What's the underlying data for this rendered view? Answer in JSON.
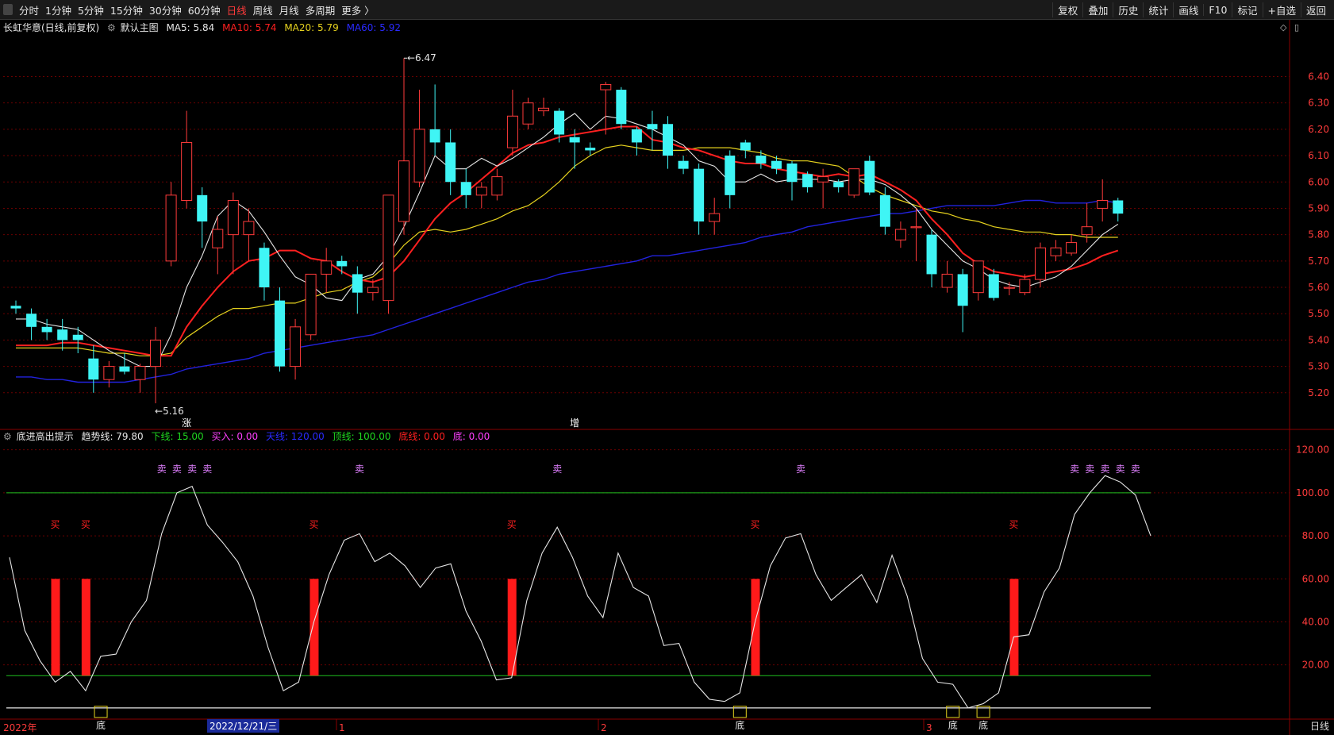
{
  "toolbar": {
    "periods": [
      "分时",
      "1分钟",
      "5分钟",
      "15分钟",
      "30分钟",
      "60分钟",
      "日线",
      "周线",
      "月线",
      "多周期",
      "更多 〉"
    ],
    "active_period": "日线",
    "tools": [
      "复权",
      "叠加",
      "历史",
      "统计",
      "画线",
      "F10",
      "标记",
      "+自选",
      "返回"
    ]
  },
  "main_legend": {
    "stock": "长虹华意(日线,前复权)",
    "view": "默认主图",
    "ma5": "MA5: 5.84",
    "ma10": "MA10: 5.74",
    "ma20": "MA20: 5.79",
    "ma60": "MA60: 5.92"
  },
  "indicator_legend": {
    "name": "底进高出提示",
    "trend": "趋势线: 79.80",
    "lower": "下线: 15.00",
    "buy": "买入: 0.00",
    "sky": "天线: 120.00",
    "top": "顶线: 100.00",
    "bottom": "底线: 0.00",
    "di": "底: 0.00"
  },
  "colors": {
    "up": "#ff3b3b",
    "down": "#3ff5f5",
    "ma5": "#e6e6e6",
    "ma10": "#ff2020",
    "ma20": "#e6d21e",
    "ma60": "#2222dd",
    "grid": "#6a0000",
    "trend": "#e6e6e6",
    "guide": "#1fbf1f",
    "buy_label": "#ff2020",
    "sell_label": "#e080ff",
    "di_box": "#e6d21e"
  },
  "bottom_axis": {
    "year_label": "2022年",
    "date_highlight": "2022/12/21/三",
    "month_labels": [
      "1",
      "2",
      "3"
    ],
    "period_label": "日线"
  },
  "chart_data": [
    {
      "type": "candlestick",
      "title": "长虹华意(日线,前复权)",
      "y_ticks": [
        5.2,
        5.3,
        5.4,
        5.5,
        5.6,
        5.7,
        5.8,
        5.9,
        6.0,
        6.1,
        6.2,
        6.3,
        6.4
      ],
      "ylim": [
        5.1,
        6.54
      ],
      "high_annotation": "6.47",
      "low_annotation": "←5.16",
      "markers": [
        {
          "index": 11,
          "text": "涨"
        },
        {
          "index": 36,
          "text": "增"
        }
      ],
      "candles": [
        [
          5.53,
          5.55,
          5.5,
          5.52
        ],
        [
          5.5,
          5.52,
          5.4,
          5.45
        ],
        [
          5.45,
          5.48,
          5.4,
          5.43
        ],
        [
          5.44,
          5.48,
          5.36,
          5.4
        ],
        [
          5.42,
          5.45,
          5.35,
          5.4
        ],
        [
          5.33,
          5.38,
          5.2,
          5.25
        ],
        [
          5.25,
          5.32,
          5.22,
          5.3
        ],
        [
          5.3,
          5.35,
          5.27,
          5.28
        ],
        [
          5.25,
          5.31,
          5.2,
          5.3
        ],
        [
          5.3,
          5.45,
          5.16,
          5.4
        ],
        [
          5.7,
          6.0,
          5.68,
          5.95
        ],
        [
          5.93,
          6.27,
          5.9,
          6.15
        ],
        [
          5.95,
          5.98,
          5.75,
          5.85
        ],
        [
          5.75,
          5.87,
          5.65,
          5.82
        ],
        [
          5.8,
          5.96,
          5.65,
          5.93
        ],
        [
          5.8,
          5.9,
          5.7,
          5.85
        ],
        [
          5.75,
          5.77,
          5.55,
          5.6
        ],
        [
          5.55,
          5.6,
          5.28,
          5.3
        ],
        [
          5.3,
          5.48,
          5.25,
          5.45
        ],
        [
          5.42,
          5.65,
          5.4,
          5.65
        ],
        [
          5.65,
          5.75,
          5.58,
          5.7
        ],
        [
          5.7,
          5.72,
          5.65,
          5.68
        ],
        [
          5.65,
          5.68,
          5.5,
          5.58
        ],
        [
          5.58,
          5.63,
          5.55,
          5.6
        ],
        [
          5.55,
          5.95,
          5.5,
          5.95
        ],
        [
          5.85,
          6.47,
          5.8,
          6.08
        ],
        [
          6.0,
          6.35,
          5.98,
          6.2
        ],
        [
          6.2,
          6.37,
          6.1,
          6.15
        ],
        [
          6.15,
          6.2,
          5.95,
          6.0
        ],
        [
          6.0,
          6.05,
          5.9,
          5.95
        ],
        [
          5.95,
          6.0,
          5.9,
          5.98
        ],
        [
          5.95,
          6.05,
          5.93,
          6.02
        ],
        [
          6.13,
          6.35,
          6.1,
          6.25
        ],
        [
          6.22,
          6.32,
          6.2,
          6.3
        ],
        [
          6.27,
          6.32,
          6.25,
          6.28
        ],
        [
          6.27,
          6.28,
          6.15,
          6.18
        ],
        [
          6.17,
          6.2,
          6.05,
          6.15
        ],
        [
          6.13,
          6.15,
          6.1,
          6.12
        ],
        [
          6.35,
          6.38,
          6.18,
          6.37
        ],
        [
          6.35,
          6.36,
          6.2,
          6.22
        ],
        [
          6.2,
          6.21,
          6.1,
          6.15
        ],
        [
          6.22,
          6.27,
          6.12,
          6.2
        ],
        [
          6.22,
          6.25,
          6.05,
          6.1
        ],
        [
          6.08,
          6.1,
          6.03,
          6.05
        ],
        [
          6.05,
          6.07,
          5.8,
          5.85
        ],
        [
          5.85,
          5.94,
          5.8,
          5.88
        ],
        [
          6.1,
          6.12,
          5.9,
          5.95
        ],
        [
          6.15,
          6.16,
          6.09,
          6.12
        ],
        [
          6.1,
          6.12,
          6.05,
          6.07
        ],
        [
          6.08,
          6.1,
          6.03,
          6.05
        ],
        [
          6.07,
          6.08,
          5.93,
          6.0
        ],
        [
          6.03,
          6.04,
          5.96,
          5.98
        ],
        [
          6.0,
          6.05,
          5.9,
          6.02
        ],
        [
          6.0,
          6.01,
          5.96,
          5.98
        ],
        [
          5.95,
          6.05,
          5.94,
          6.05
        ],
        [
          6.08,
          6.1,
          5.95,
          5.96
        ],
        [
          5.95,
          5.98,
          5.8,
          5.83
        ],
        [
          5.78,
          5.85,
          5.75,
          5.82
        ],
        [
          5.83,
          5.9,
          5.7,
          5.83
        ],
        [
          5.8,
          5.82,
          5.6,
          5.65
        ],
        [
          5.6,
          5.7,
          5.58,
          5.65
        ],
        [
          5.65,
          5.67,
          5.43,
          5.53
        ],
        [
          5.58,
          5.7,
          5.55,
          5.7
        ],
        [
          5.65,
          5.67,
          5.55,
          5.56
        ],
        [
          5.6,
          5.62,
          5.57,
          5.6
        ],
        [
          5.58,
          5.65,
          5.57,
          5.63
        ],
        [
          5.63,
          5.77,
          5.6,
          5.75
        ],
        [
          5.72,
          5.78,
          5.7,
          5.75
        ],
        [
          5.73,
          5.8,
          5.72,
          5.77
        ],
        [
          5.8,
          5.92,
          5.77,
          5.83
        ],
        [
          5.9,
          6.01,
          5.85,
          5.93
        ],
        [
          5.93,
          5.94,
          5.85,
          5.88
        ]
      ],
      "ma": {
        "MA5": [
          5.48,
          5.48,
          5.46,
          5.45,
          5.44,
          5.4,
          5.36,
          5.33,
          5.3,
          5.3,
          5.42,
          5.6,
          5.72,
          5.87,
          5.93,
          5.89,
          5.81,
          5.72,
          5.64,
          5.61,
          5.56,
          5.55,
          5.63,
          5.65,
          5.72,
          5.83,
          5.96,
          6.1,
          6.05,
          6.05,
          6.09,
          6.06,
          6.09,
          6.13,
          6.17,
          6.22,
          6.26,
          6.2,
          6.25,
          6.24,
          6.22,
          6.2,
          6.17,
          6.14,
          6.08,
          6.06,
          6.0,
          6.0,
          6.03,
          6.0,
          6.01,
          6.01,
          6.01,
          6.0,
          6.01,
          6.01,
          5.99,
          5.95,
          5.9,
          5.82,
          5.76,
          5.7,
          5.67,
          5.63,
          5.61,
          5.6,
          5.62,
          5.64,
          5.68,
          5.74,
          5.8,
          5.84
        ],
        "MA10": [
          5.38,
          5.38,
          5.38,
          5.39,
          5.39,
          5.38,
          5.37,
          5.36,
          5.35,
          5.34,
          5.34,
          5.45,
          5.53,
          5.6,
          5.66,
          5.7,
          5.71,
          5.74,
          5.74,
          5.71,
          5.7,
          5.66,
          5.63,
          5.62,
          5.64,
          5.7,
          5.78,
          5.86,
          5.92,
          5.96,
          6.01,
          6.06,
          6.11,
          6.14,
          6.15,
          6.17,
          6.18,
          6.19,
          6.2,
          6.21,
          6.21,
          6.16,
          6.15,
          6.13,
          6.12,
          6.1,
          6.08,
          6.07,
          6.07,
          6.05,
          6.04,
          6.03,
          6.02,
          6.03,
          6.02,
          6.03,
          6.0,
          5.97,
          5.93,
          5.86,
          5.8,
          5.73,
          5.69,
          5.66,
          5.65,
          5.64,
          5.65,
          5.66,
          5.67,
          5.69,
          5.72,
          5.74
        ],
        "MA20": [
          5.37,
          5.37,
          5.37,
          5.37,
          5.37,
          5.36,
          5.35,
          5.35,
          5.34,
          5.34,
          5.35,
          5.41,
          5.45,
          5.49,
          5.52,
          5.52,
          5.53,
          5.54,
          5.54,
          5.56,
          5.58,
          5.59,
          5.62,
          5.64,
          5.69,
          5.76,
          5.81,
          5.82,
          5.81,
          5.82,
          5.84,
          5.86,
          5.89,
          5.91,
          5.95,
          6.0,
          6.06,
          6.1,
          6.13,
          6.14,
          6.13,
          6.12,
          6.12,
          6.12,
          6.13,
          6.13,
          6.13,
          6.12,
          6.11,
          6.09,
          6.08,
          6.08,
          6.07,
          6.06,
          6.02,
          5.98,
          5.95,
          5.93,
          5.91,
          5.89,
          5.88,
          5.86,
          5.85,
          5.83,
          5.82,
          5.81,
          5.81,
          5.8,
          5.8,
          5.79,
          5.79,
          5.79
        ],
        "MA60": [
          5.26,
          5.26,
          5.25,
          5.25,
          5.24,
          5.24,
          5.24,
          5.24,
          5.25,
          5.26,
          5.27,
          5.29,
          5.3,
          5.31,
          5.32,
          5.33,
          5.35,
          5.36,
          5.37,
          5.38,
          5.39,
          5.4,
          5.41,
          5.42,
          5.44,
          5.46,
          5.48,
          5.5,
          5.52,
          5.54,
          5.56,
          5.58,
          5.6,
          5.62,
          5.63,
          5.65,
          5.66,
          5.67,
          5.68,
          5.69,
          5.7,
          5.72,
          5.72,
          5.73,
          5.74,
          5.75,
          5.76,
          5.77,
          5.79,
          5.8,
          5.81,
          5.83,
          5.84,
          5.85,
          5.86,
          5.87,
          5.88,
          5.88,
          5.89,
          5.9,
          5.91,
          5.91,
          5.91,
          5.91,
          5.92,
          5.93,
          5.93,
          5.92,
          5.92,
          5.92,
          5.93,
          5.92
        ]
      }
    },
    {
      "type": "line",
      "title": "底进高出提示",
      "y_ticks": [
        20.0,
        40.0,
        60.0,
        80.0,
        100.0,
        120.0
      ],
      "ylim": [
        -3,
        128
      ],
      "guides": {
        "top": 100,
        "lower": 15,
        "bottom": 0
      },
      "trend": [
        70,
        36,
        22,
        12,
        17,
        8,
        24,
        25,
        40,
        50,
        81,
        100,
        103,
        85,
        77,
        68,
        52,
        28,
        8,
        12,
        40,
        62,
        78,
        81,
        68,
        72,
        66,
        56,
        65,
        67,
        45,
        31,
        13,
        14,
        50,
        72,
        84,
        70,
        52,
        42,
        72,
        56,
        52,
        29,
        30,
        12,
        4,
        3,
        7,
        40,
        66,
        79,
        81,
        62,
        50,
        56,
        62,
        49,
        71,
        52,
        23,
        12,
        11,
        0,
        2,
        7,
        33,
        34,
        54,
        65,
        90,
        100,
        108,
        105,
        99,
        80
      ],
      "buy_signals": {
        "label": "买",
        "indices": [
          3,
          5,
          20,
          33,
          49,
          66
        ]
      },
      "sell_signals": {
        "label": "卖",
        "indices": [
          10,
          11,
          12,
          13,
          23,
          36,
          52,
          70,
          71,
          72,
          73,
          74
        ]
      },
      "di_signals": {
        "label": "底",
        "indices": [
          6,
          48,
          62,
          64
        ]
      }
    }
  ]
}
